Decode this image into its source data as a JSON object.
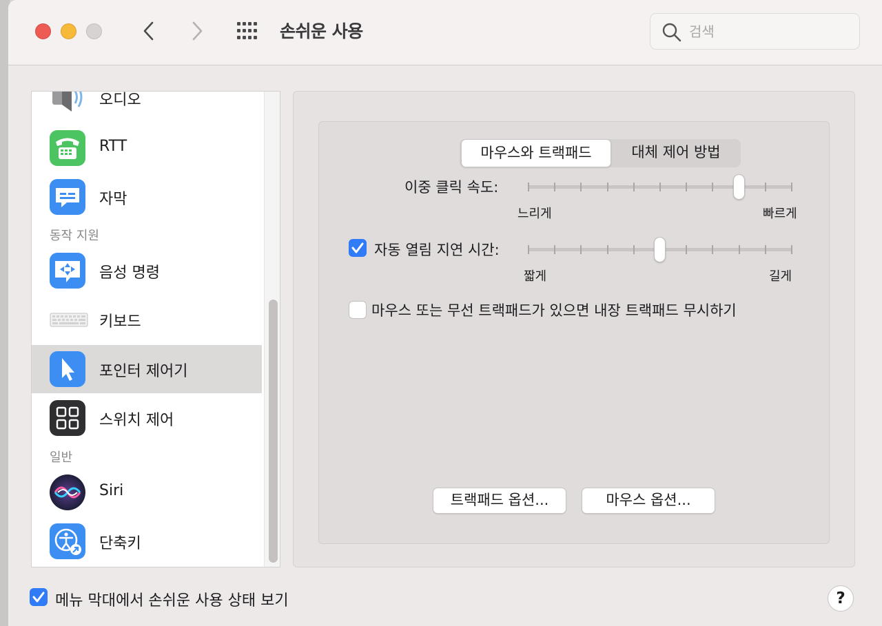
{
  "window": {
    "title": "손쉬운 사용"
  },
  "search": {
    "placeholder": "검색",
    "icon": "magnifier-icon"
  },
  "sidebar": {
    "items": [
      {
        "label": "오디오",
        "icon": "speaker-icon"
      },
      {
        "label": "RTT",
        "icon": "rtt-phone-icon"
      },
      {
        "label": "자막",
        "icon": "captions-icon"
      },
      {
        "label": "음성 명령",
        "icon": "voice-control-icon"
      },
      {
        "label": "키보드",
        "icon": "keyboard-icon"
      },
      {
        "label": "포인터 제어기",
        "icon": "pointer-icon",
        "selected": true
      },
      {
        "label": "스위치 제어",
        "icon": "switch-control-icon"
      },
      {
        "label": "Siri",
        "icon": "siri-icon"
      },
      {
        "label": "단축키",
        "icon": "accessibility-shortcut-icon"
      }
    ],
    "headers": {
      "motor": "동작 지원",
      "general": "일반"
    }
  },
  "tabs": [
    {
      "label": "마우스와 트랙패드",
      "active": true
    },
    {
      "label": "대체 제어 방법",
      "active": false
    }
  ],
  "double_click": {
    "label": "이중 클릭 속도:",
    "min_label": "느리게",
    "max_label": "빠르게",
    "ticks": 11,
    "value_fraction": 0.8
  },
  "spring_loading": {
    "label": "자동 열림 지연 시간:",
    "min_label": "짧게",
    "max_label": "길게",
    "checked": true,
    "ticks": 11,
    "value_fraction": 0.5
  },
  "ignore_builtin": {
    "label": "마우스 또는 무선 트랙패드가 있으면 내장 트랙패드 무시하기",
    "checked": false
  },
  "buttons": {
    "trackpad_options": "트랙패드 옵션...",
    "mouse_options": "마우스 옵션..."
  },
  "footer": {
    "show_in_menu_bar": "메뉴 막대에서 손쉬운 사용 상태 보기",
    "checked": true,
    "help": "?"
  },
  "colors": {
    "accent": "#2f7cf6",
    "close": "#ee5b55",
    "minimize": "#f6b93a"
  }
}
